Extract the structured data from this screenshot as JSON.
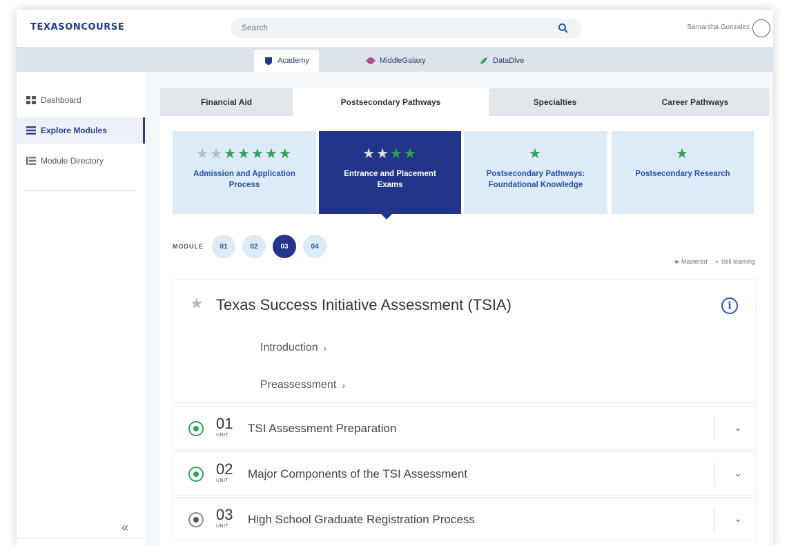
{
  "header": {
    "logo": "TEXASONCOURSE",
    "search_placeholder": "Search",
    "user_name": "Samantha Gonzalez"
  },
  "apps": [
    {
      "label": "Academy",
      "icon": "academy-shield-icon",
      "color": "#23358a"
    },
    {
      "label": "MiddleGalaxy",
      "icon": "galaxy-icon",
      "color": "#c0577a"
    },
    {
      "label": "DataDive",
      "icon": "datadive-icon",
      "color": "#2fa35a"
    }
  ],
  "sidebar": {
    "items": [
      {
        "label": "Dashboard",
        "icon": "dashboard-icon"
      },
      {
        "label": "Explore Modules",
        "icon": "list-icon",
        "active": true
      },
      {
        "label": "Module Directory",
        "icon": "directory-icon"
      }
    ],
    "collapse": "«"
  },
  "tabs": [
    "Financial Aid",
    "Postsecondary Pathways",
    "Specialties",
    "Career Pathways"
  ],
  "cards": [
    {
      "title": "Admission and Application Process",
      "stars_mastered": 5,
      "stars_learning": 2
    },
    {
      "title": "Entrance and Placement Exams",
      "stars_mastered": 2,
      "stars_learning": 2,
      "active": true
    },
    {
      "title": "Postsecondary Pathways: Foundational Knowledge",
      "stars_mastered": 1,
      "stars_learning": 0
    },
    {
      "title": "Postsecondary Research",
      "stars_mastered": 1,
      "stars_learning": 0
    }
  ],
  "module": {
    "label": "MODULE",
    "pills": [
      "01",
      "02",
      "03",
      "04"
    ],
    "active_index": 2,
    "legend_mastered": "Mastered",
    "legend_learning": "Still learning"
  },
  "panel": {
    "title": "Texas Success Initiative Assessment (TSIA)",
    "links": [
      "Introduction",
      "Preassessment"
    ]
  },
  "units": [
    {
      "num": "01",
      "sub": "UNIT",
      "title": "TSI Assessment Preparation",
      "status": "mastered"
    },
    {
      "num": "02",
      "sub": "UNIT",
      "title": "Major Components of the TSI Assessment",
      "status": "mastered"
    },
    {
      "num": "03",
      "sub": "UNIT",
      "title": "High School Graduate Registration Process",
      "status": "learning"
    }
  ],
  "colors": {
    "brand": "#23358a",
    "mastered": "#2fa35a",
    "learning": "#b8bdc4",
    "card_bg": "#dcebf7"
  }
}
